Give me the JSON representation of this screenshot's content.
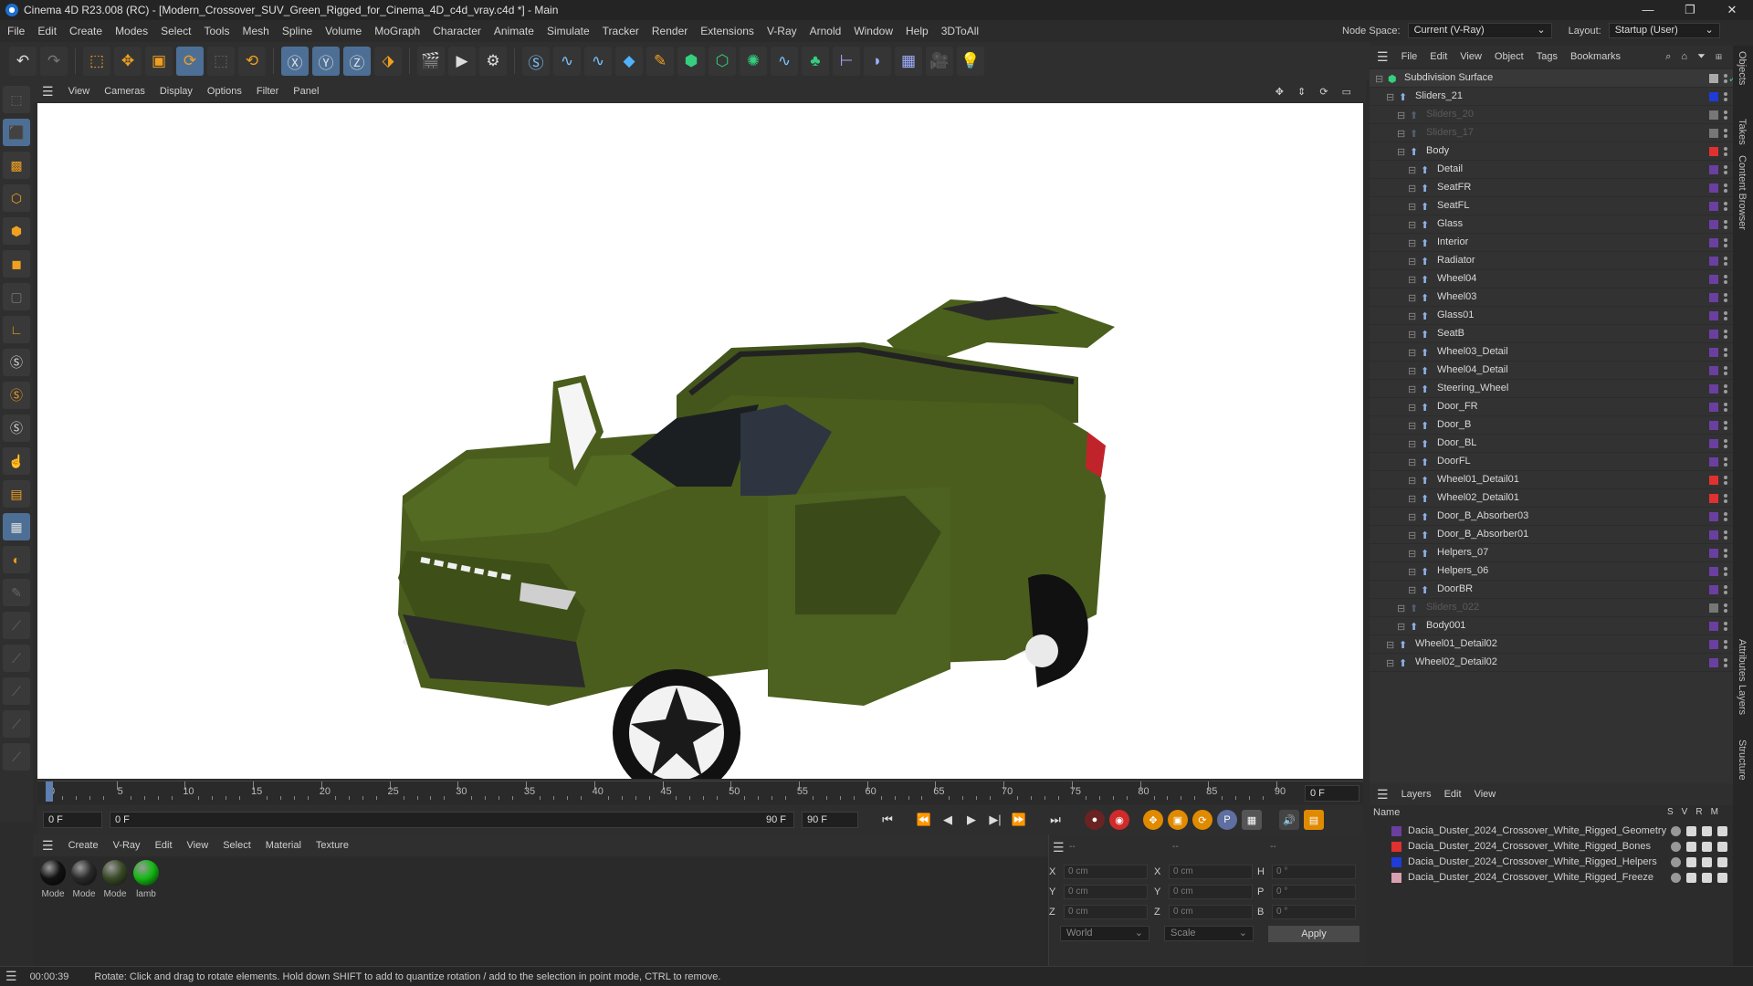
{
  "window": {
    "title": "Cinema 4D R23.008 (RC) - [Modern_Crossover_SUV_Green_Rigged_for_Cinema_4D_c4d_vray.c4d *] - Main",
    "minimize": "—",
    "maximize": "❐",
    "close": "✕"
  },
  "menu": {
    "items": [
      "File",
      "Edit",
      "Create",
      "Modes",
      "Select",
      "Tools",
      "Mesh",
      "Spline",
      "Volume",
      "MoGraph",
      "Character",
      "Animate",
      "Simulate",
      "Tracker",
      "Render",
      "Extensions",
      "V-Ray",
      "Arnold",
      "Window",
      "Help",
      "3DToAll"
    ],
    "node_space_label": "Node Space:",
    "node_space_value": "Current (V-Ray)",
    "layout_label": "Layout:",
    "layout_value": "Startup (User)"
  },
  "viewport": {
    "menu": [
      "View",
      "Cameras",
      "Display",
      "Options",
      "Filter",
      "Panel"
    ]
  },
  "timeline": {
    "ticks": [
      "0",
      "5",
      "10",
      "15",
      "20",
      "25",
      "30",
      "35",
      "40",
      "45",
      "50",
      "55",
      "60",
      "65",
      "70",
      "75",
      "80",
      "85",
      "90"
    ],
    "frame_readout": "0 F",
    "start_field": "0 F",
    "current_field": "0 F",
    "end_field": "90 F",
    "max_field": "90 F"
  },
  "materials": {
    "menu": [
      "Create",
      "V-Ray",
      "Edit",
      "View",
      "Select",
      "Material",
      "Texture"
    ],
    "items": [
      {
        "label": "Mode",
        "color": "#121212"
      },
      {
        "label": "Mode",
        "color": "#2a2a2a"
      },
      {
        "label": "Mode",
        "color": "#3a4a26"
      },
      {
        "label": "lamb",
        "color": "#14b814"
      }
    ]
  },
  "coords": {
    "x_pos": "0 cm",
    "y_pos": "0 cm",
    "z_pos": "0 cm",
    "x_size": "0 cm",
    "y_size": "0 cm",
    "z_size": "0 cm",
    "h": "0 °",
    "p": "0 °",
    "b": "0 °",
    "header_a": "--",
    "header_b": "--",
    "header_c": "--",
    "mode_world": "World",
    "mode_scale": "Scale",
    "apply": "Apply"
  },
  "objects": {
    "menu": [
      "File",
      "Edit",
      "View",
      "Object",
      "Tags",
      "Bookmarks"
    ],
    "rows": [
      {
        "name": "Subdivision Surface",
        "depth": 0,
        "color": "#aaaaaa",
        "dim": false
      },
      {
        "name": "Sliders_21",
        "depth": 1,
        "color": "#1f3bd8",
        "dim": false
      },
      {
        "name": "Sliders_20",
        "depth": 2,
        "color": "#777777",
        "dim": true
      },
      {
        "name": "Sliders_17",
        "depth": 2,
        "color": "#777777",
        "dim": true
      },
      {
        "name": "Body",
        "depth": 2,
        "color": "#e03030",
        "dim": false
      },
      {
        "name": "Detail",
        "depth": 3,
        "color": "#6b3fa0",
        "dim": false
      },
      {
        "name": "SeatFR",
        "depth": 3,
        "color": "#6b3fa0",
        "dim": false
      },
      {
        "name": "SeatFL",
        "depth": 3,
        "color": "#6b3fa0",
        "dim": false
      },
      {
        "name": "Glass",
        "depth": 3,
        "color": "#6b3fa0",
        "dim": false
      },
      {
        "name": "Interior",
        "depth": 3,
        "color": "#6b3fa0",
        "dim": false
      },
      {
        "name": "Radiator",
        "depth": 3,
        "color": "#6b3fa0",
        "dim": false
      },
      {
        "name": "Wheel04",
        "depth": 3,
        "color": "#6b3fa0",
        "dim": false
      },
      {
        "name": "Wheel03",
        "depth": 3,
        "color": "#6b3fa0",
        "dim": false
      },
      {
        "name": "Glass01",
        "depth": 3,
        "color": "#6b3fa0",
        "dim": false
      },
      {
        "name": "SeatB",
        "depth": 3,
        "color": "#6b3fa0",
        "dim": false
      },
      {
        "name": "Wheel03_Detail",
        "depth": 3,
        "color": "#6b3fa0",
        "dim": false
      },
      {
        "name": "Wheel04_Detail",
        "depth": 3,
        "color": "#6b3fa0",
        "dim": false
      },
      {
        "name": "Steering_Wheel",
        "depth": 3,
        "color": "#6b3fa0",
        "dim": false
      },
      {
        "name": "Door_FR",
        "depth": 3,
        "color": "#6b3fa0",
        "dim": false
      },
      {
        "name": "Door_B",
        "depth": 3,
        "color": "#6b3fa0",
        "dim": false
      },
      {
        "name": "Door_BL",
        "depth": 3,
        "color": "#6b3fa0",
        "dim": false
      },
      {
        "name": "DoorFL",
        "depth": 3,
        "color": "#6b3fa0",
        "dim": false
      },
      {
        "name": "Wheel01_Detail01",
        "depth": 3,
        "color": "#e03030",
        "dim": false
      },
      {
        "name": "Wheel02_Detail01",
        "depth": 3,
        "color": "#e03030",
        "dim": false
      },
      {
        "name": "Door_B_Absorber03",
        "depth": 3,
        "color": "#6b3fa0",
        "dim": false
      },
      {
        "name": "Door_B_Absorber01",
        "depth": 3,
        "color": "#6b3fa0",
        "dim": false
      },
      {
        "name": "Helpers_07",
        "depth": 3,
        "color": "#6b3fa0",
        "dim": false
      },
      {
        "name": "Helpers_06",
        "depth": 3,
        "color": "#6b3fa0",
        "dim": false
      },
      {
        "name": "DoorBR",
        "depth": 3,
        "color": "#6b3fa0",
        "dim": false
      },
      {
        "name": "Sliders_022",
        "depth": 2,
        "color": "#777777",
        "dim": true
      },
      {
        "name": "Body001",
        "depth": 2,
        "color": "#6b3fa0",
        "dim": false
      },
      {
        "name": "Wheel01_Detail02",
        "depth": 1,
        "color": "#6b3fa0",
        "dim": false
      },
      {
        "name": "Wheel02_Detail02",
        "depth": 1,
        "color": "#6b3fa0",
        "dim": false
      }
    ]
  },
  "layers": {
    "menu": [
      "Layers",
      "Edit",
      "View"
    ],
    "header_name": "Name",
    "header_cols": [
      "S",
      "V",
      "R",
      "M"
    ],
    "rows": [
      {
        "name": "Dacia_Duster_2024_Crossover_White_Rigged_Geometry",
        "color": "#6b3fa0"
      },
      {
        "name": "Dacia_Duster_2024_Crossover_White_Rigged_Bones",
        "color": "#e03030"
      },
      {
        "name": "Dacia_Duster_2024_Crossover_White_Rigged_Helpers",
        "color": "#1f3bd8"
      },
      {
        "name": "Dacia_Duster_2024_Crossover_White_Rigged_Freeze",
        "color": "#d9a0b0"
      }
    ]
  },
  "side_tabs": [
    "Objects",
    "Takes",
    "Content Browser",
    "Attributes",
    "Layers",
    "Structure"
  ],
  "status": {
    "time": "00:00:39",
    "message": "Rotate: Click and drag to rotate elements. Hold down SHIFT to add to quantize rotation / add to the selection in point mode, CTRL to remove."
  },
  "colors": {
    "accent": "#4d6f95",
    "car_body": "#4a5d1d",
    "viewport_bg": "#ffffff"
  }
}
